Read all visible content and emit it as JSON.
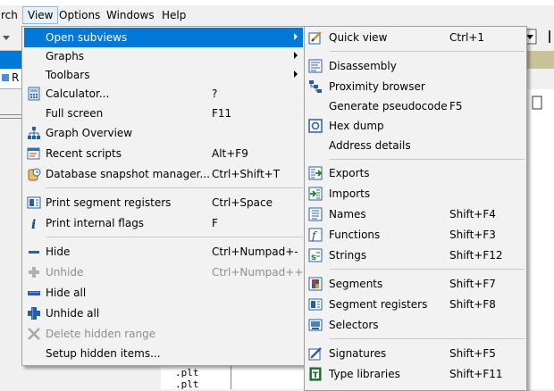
{
  "menubar": {
    "search_partial": "rch",
    "view": "View",
    "options": "Options",
    "windows": "Windows",
    "help": "Help"
  },
  "background": {
    "tab_partial": "R",
    "plt_1": ".plt",
    "plt_2": ".plt"
  },
  "view_menu": {
    "open_subviews": "Open subviews",
    "graphs": "Graphs",
    "toolbars": "Toolbars",
    "calculator": {
      "label": "Calculator...",
      "shortcut": "?"
    },
    "full_screen": {
      "label": "Full screen",
      "shortcut": "F11"
    },
    "graph_overview": {
      "label": "Graph Overview"
    },
    "recent_scripts": {
      "label": "Recent scripts",
      "shortcut": "Alt+F9"
    },
    "db_snapshot": {
      "label": "Database snapshot manager...",
      "shortcut": "Ctrl+Shift+T"
    },
    "print_segment_registers": {
      "label": "Print segment registers",
      "shortcut": "Ctrl+Space"
    },
    "print_internal_flags": {
      "label": "Print internal flags",
      "shortcut": "F"
    },
    "hide": {
      "label": "Hide",
      "shortcut": "Ctrl+Numpad+-"
    },
    "unhide": {
      "label": "Unhide",
      "shortcut": "Ctrl+Numpad++"
    },
    "hide_all": {
      "label": "Hide all"
    },
    "unhide_all": {
      "label": "Unhide all"
    },
    "delete_hidden_range": {
      "label": "Delete hidden range"
    },
    "setup_hidden_items": {
      "label": "Setup hidden items..."
    }
  },
  "subviews_menu": {
    "quick_view": {
      "label": "Quick view",
      "shortcut": "Ctrl+1"
    },
    "disassembly": {
      "label": "Disassembly"
    },
    "proximity_browser": {
      "label": "Proximity browser"
    },
    "generate_pseudocode": {
      "label": "Generate pseudocode",
      "shortcut": "F5"
    },
    "hex_dump": {
      "label": "Hex dump"
    },
    "address_details": {
      "label": "Address details"
    },
    "exports": {
      "label": "Exports"
    },
    "imports": {
      "label": "Imports"
    },
    "names": {
      "label": "Names",
      "shortcut": "Shift+F4"
    },
    "functions": {
      "label": "Functions",
      "shortcut": "Shift+F3"
    },
    "strings": {
      "label": "Strings",
      "shortcut": "Shift+F12"
    },
    "segments": {
      "label": "Segments",
      "shortcut": "Shift+F7"
    },
    "segment_registers": {
      "label": "Segment registers",
      "shortcut": "Shift+F8"
    },
    "selectors": {
      "label": "Selectors"
    },
    "signatures": {
      "label": "Signatures",
      "shortcut": "Shift+F5"
    },
    "type_libraries": {
      "label": "Type libraries",
      "shortcut": "Shift+F11"
    }
  },
  "colors": {
    "highlight": "#0078d7",
    "menu_bg": "#f2f2f2",
    "disabled_text": "#8d8d8d"
  }
}
